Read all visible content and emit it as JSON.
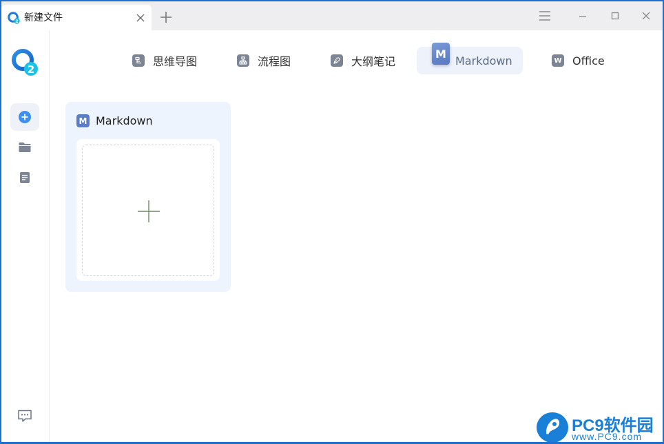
{
  "tab": {
    "title": "新建文件"
  },
  "categories": [
    {
      "label": "思维导图",
      "icon": "mindmap-icon"
    },
    {
      "label": "流程图",
      "icon": "flowchart-icon"
    },
    {
      "label": "大纲笔记",
      "icon": "outline-note-icon"
    },
    {
      "label": "Markdown",
      "icon": "markdown-icon",
      "badge": "M"
    },
    {
      "label": "Office",
      "icon": "office-word-icon",
      "badge": "W"
    }
  ],
  "card": {
    "badge": "M",
    "title": "Markdown"
  },
  "watermark": {
    "name": "PC9软件园",
    "url": "www.PC9.com"
  },
  "colors": {
    "accent": "#5c7cc7",
    "window_border": "#1e6fd0",
    "card_bg": "#eef4fd"
  }
}
